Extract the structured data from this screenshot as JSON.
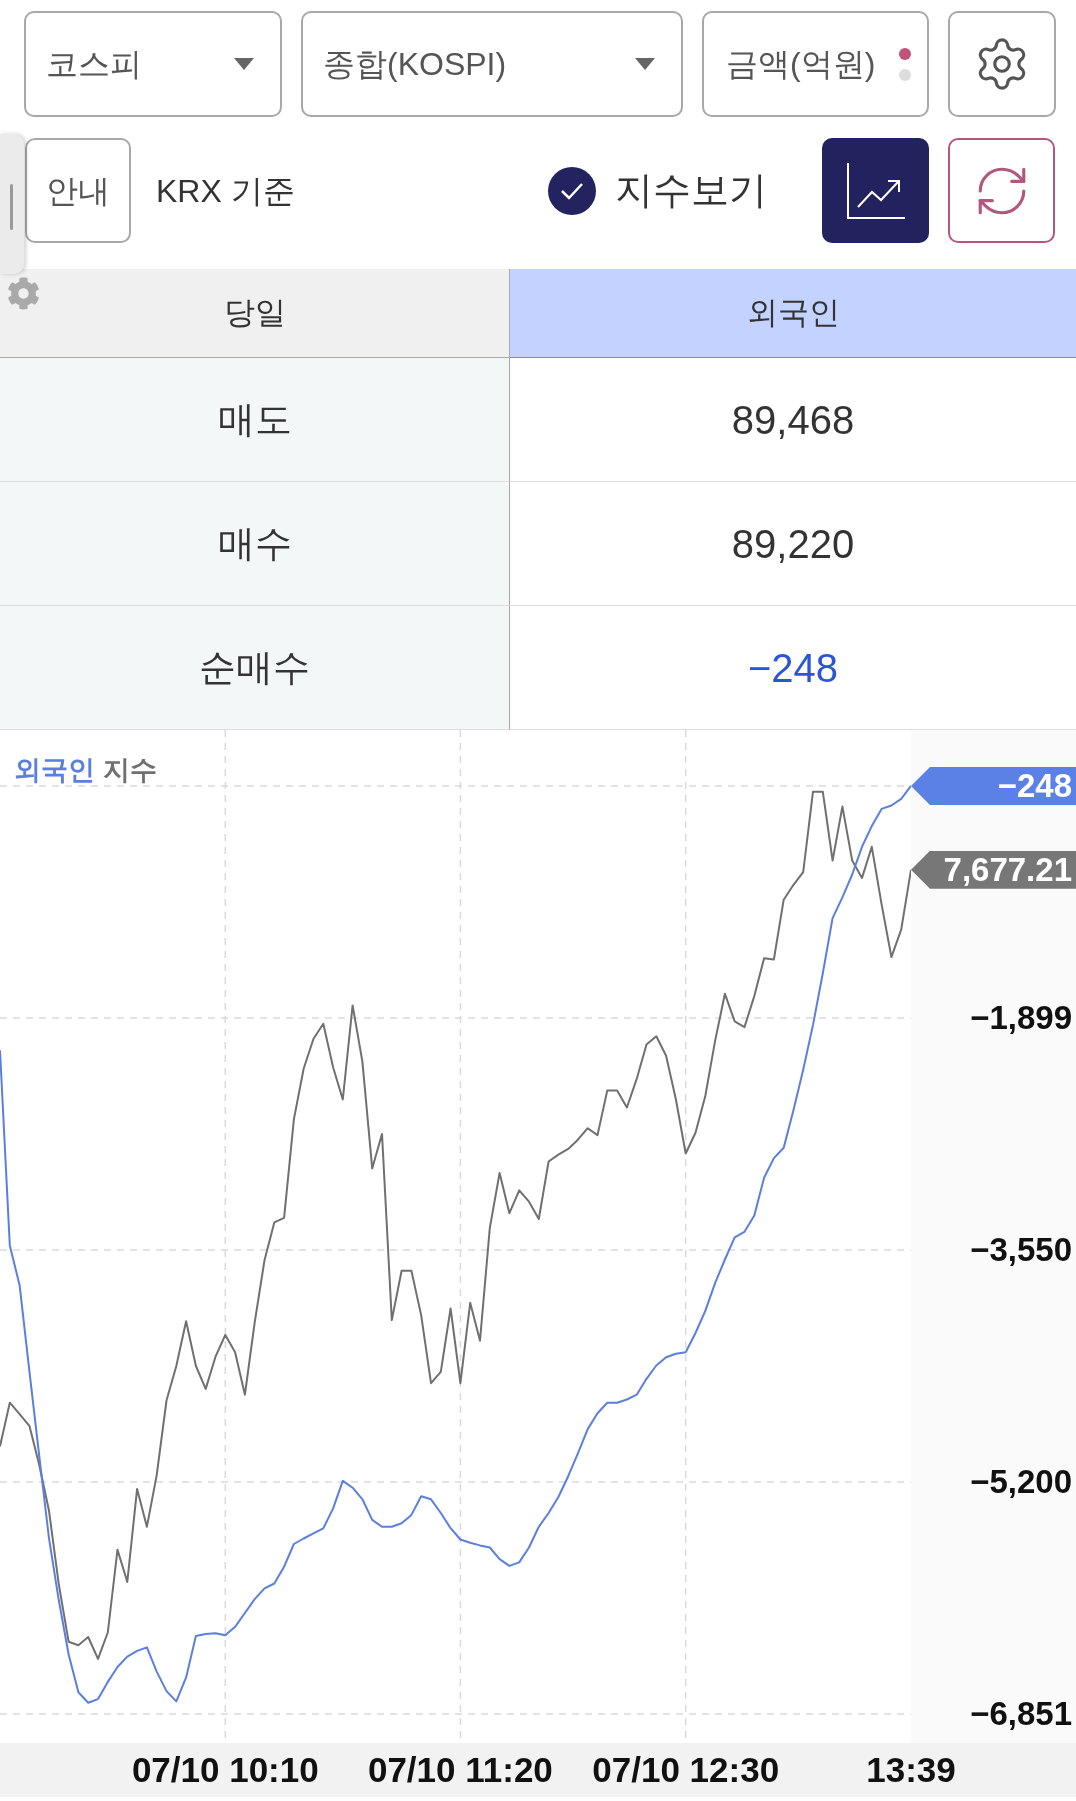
{
  "toolbar": {
    "dropdowns": [
      {
        "label": "코스피"
      },
      {
        "label": "종합(KOSPI)"
      }
    ],
    "unit_toggle": {
      "label": "금액(억원)",
      "indicator": [
        {
          "selected": true
        },
        {
          "selected": false
        }
      ]
    }
  },
  "options": {
    "guide_button": "안내",
    "basis": "KRX 기준",
    "index_toggle": {
      "label": "지수보기",
      "checked": true
    },
    "chart_view": {
      "selected": true
    }
  },
  "table": {
    "columns": [
      "당일",
      "외국인"
    ],
    "rows": [
      {
        "label": "매도",
        "value": "89,468",
        "color": "#333333"
      },
      {
        "label": "매수",
        "value": "89,220",
        "color": "#333333"
      },
      {
        "label": "순매수",
        "value": "−248",
        "color": "#2b55d8"
      }
    ]
  },
  "chart": {
    "tags": [
      {
        "label": "−248",
        "color": "#5b80e6"
      },
      {
        "label": "7,677.21",
        "color": "#777777"
      }
    ],
    "chart_data": {
      "type": "line",
      "grid": true,
      "categories": [
        null,
        null,
        null,
        null,
        null,
        null,
        null,
        null,
        null,
        null,
        null,
        null,
        null,
        null,
        null,
        null,
        null,
        null,
        null,
        null,
        null,
        null,
        null,
        "07/10 10:10",
        null,
        null,
        null,
        null,
        null,
        null,
        null,
        null,
        null,
        null,
        null,
        null,
        null,
        null,
        null,
        null,
        null,
        null,
        null,
        null,
        null,
        null,
        null,
        "07/10 11:20",
        null,
        null,
        null,
        null,
        null,
        null,
        null,
        null,
        null,
        null,
        null,
        null,
        null,
        null,
        null,
        null,
        null,
        null,
        null,
        null,
        null,
        null,
        "07/10 12:30",
        null,
        null,
        null,
        null,
        null,
        null,
        null,
        null,
        null,
        null,
        null,
        null,
        null,
        null,
        null,
        null,
        null,
        null,
        null,
        null,
        null,
        null,
        "13:39"
      ],
      "series": [
        {
          "name": "외국인",
          "color": "#5b7fe0",
          "values": [
            -2128,
            -3517,
            -3800,
            -4412,
            -5012,
            -5601,
            -6042,
            -6426,
            -6696,
            -6770,
            -6745,
            -6622,
            -6516,
            -6442,
            -6402,
            -6377,
            -6549,
            -6688,
            -6761,
            -6590,
            -6295,
            -6281,
            -6276,
            -6290,
            -6230,
            -6132,
            -6034,
            -5957,
            -5922,
            -5803,
            -5641,
            -5602,
            -5565,
            -5530,
            -5388,
            -5192,
            -5241,
            -5323,
            -5470,
            -5519,
            -5519,
            -5494,
            -5434,
            -5301,
            -5323,
            -5421,
            -5529,
            -5609,
            -5633,
            -5651,
            -5666,
            -5749,
            -5797,
            -5772,
            -5666,
            -5519,
            -5421,
            -5307,
            -5159,
            -4996,
            -4824,
            -4711,
            -4636,
            -4636,
            -4613,
            -4579,
            -4466,
            -4371,
            -4313,
            -4287,
            -4277,
            -4140,
            -3983,
            -3786,
            -3617,
            -3460,
            -3420,
            -3304,
            -3035,
            -2896,
            -2822,
            -2553,
            -2267,
            -1948,
            -1580,
            -1188,
            -1041,
            -878,
            -681,
            -534,
            -411,
            -387,
            -340,
            -248
          ]
        },
        {
          "name": "지수",
          "color": "#707070",
          "values": [
            -4947,
            -4636,
            -4718,
            -4800,
            -5078,
            -5405,
            -5928,
            -6336,
            -6361,
            -6303,
            -6459,
            -6271,
            -5682,
            -5911,
            -5249,
            -5519,
            -5151,
            -4620,
            -4375,
            -4056,
            -4375,
            -4538,
            -4309,
            -4154,
            -4277,
            -4579,
            -4064,
            -3623,
            -3353,
            -3321,
            -2618,
            -2258,
            -2046,
            -1940,
            -2250,
            -2479,
            -1809,
            -2209,
            -2969,
            -2724,
            -4048,
            -3697,
            -3697,
            -4015,
            -4497,
            -4416,
            -3966,
            -4497,
            -3925,
            -4195,
            -3394,
            -3002,
            -3288,
            -3125,
            -3206,
            -3329,
            -2920,
            -2871,
            -2830,
            -2765,
            -2683,
            -2732,
            -2414,
            -2414,
            -2536,
            -2332,
            -2087,
            -2029,
            -2168,
            -2479,
            -2863,
            -2716,
            -2454,
            -2062,
            -1727,
            -1923,
            -1964,
            -1743,
            -1474,
            -1482,
            -1057,
            -951,
            -861,
            -289,
            -289,
            -779,
            -395,
            -779,
            -902,
            -681,
            -1090,
            -1466,
            -1270,
            -845
          ]
        }
      ],
      "ylim": [
        -7057,
        150
      ],
      "yticks": [
        {
          "value": -1899,
          "label": "−1,899"
        },
        {
          "value": -3550,
          "label": "−3,550"
        },
        {
          "value": -5200,
          "label": "−5,200"
        },
        {
          "value": -6851,
          "label": "−6,851"
        }
      ]
    }
  }
}
